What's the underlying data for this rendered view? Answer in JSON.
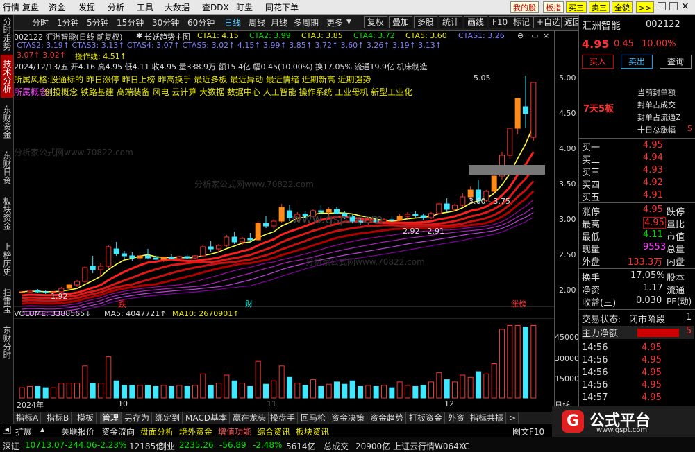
{
  "menu": [
    "行情",
    "复盘",
    "资金",
    "发掘",
    "分析",
    "工具",
    "大数据",
    "查DDX",
    "盯盘",
    "同花下单"
  ],
  "menu_right": {
    "mine": "我的股",
    "board": "板指",
    "b3": "买三",
    "s3": "卖三",
    "all": "全貌",
    "more": ">>"
  },
  "toolbar": {
    "periods": [
      "分时",
      "1分钟",
      "5分钟",
      "15分钟",
      "30分钟",
      "60分钟",
      "日线",
      "周线",
      "月线",
      "多周期",
      "更多"
    ],
    "buttons": [
      "复权",
      "叠加",
      "多股",
      "统计",
      "画线",
      "F10",
      "标记",
      "+自选",
      "返回"
    ]
  },
  "lefttabs": [
    "分时走势",
    "技术分析",
    "东财资金",
    "东财日资",
    "板块资金",
    "上榜历史",
    "扫雷宝",
    "东财分时"
  ],
  "chart": {
    "title_code": "002122 汇洲智能(日线 前复权)",
    "indicator_name": "长妖趋势主图",
    "cta_values": [
      {
        "label": "CTA1: 4.15",
        "color": "#e8e800"
      },
      {
        "label": "CTA2: 3.99",
        "color": "#00e000"
      },
      {
        "label": "CTA3: 3.85",
        "color": "#e8e800"
      },
      {
        "label": "CTA4: 3.72",
        "color": "#00e000"
      },
      {
        "label": "CTA5: 3.60",
        "color": "#e8e800"
      },
      {
        "label": "CTAS1: 3.26",
        "color": "#8080ff"
      }
    ],
    "row2": "CTAS2: 3.19↑ CTAS3: 3.13↑ CTAS4: 3.07↑ CTAS5: 3.02↑ 4.15↑ 3.99↑ 3.85↑ 3.72↑ 3.60↑ 3.26↑ 3.19↑ 3.13↑",
    "row3_a": "3.07↑ 3.02↑",
    "row3_b": "操作线: 4.51↑",
    "ohlc": "2024/12/13/五 开4.16 高4.95 低4.11 收4.95 量338.9万 额15.4亿 幅0.45(10.00%) 换17.05% 流通19.9亿 机床制造",
    "concept1": "所属风格:股通标的 昨日涨停 昨日上榜 昨高换手 最近多板 最近异动 最近情绪 近期新高 近期强势",
    "concept2_label": "所属概念:",
    "concept2": "创投概念 铁路基建 高端装备 风电 云计算 大数据 数据中心 人工智能 操作系统 工业母机 新型工业化",
    "watermark": "分析家公式网www.70822.com",
    "watermark2": "www.gspt.com",
    "price_labels": [
      "5.00",
      "4.50",
      "4.00",
      "3.50",
      "3.00",
      "2.50",
      "2.00"
    ],
    "annot_high": "5.05",
    "annot_seven": "7天5板",
    "annot_range1": "3.60 - 3.75",
    "annot_range2": "2.92 - 2.91",
    "annot_low": "1.92",
    "marks": [
      "跌",
      "财",
      "涨榜"
    ],
    "volume_label": "VOLUME: 3388565↓",
    "ma5_label": "MA5: 4047721↑",
    "ma10_label": "MA10: 2670901↑",
    "vol_axis": [
      "45000",
      "30000",
      "15000"
    ],
    "x_labels": [
      "2024年",
      "10",
      "11",
      "12"
    ],
    "period_label": "日线"
  },
  "chart_data": {
    "type": "candlestick",
    "price_range": [
      1.8,
      5.1
    ],
    "candles": [
      [
        1.92,
        1.95,
        1.9,
        1.93
      ],
      [
        1.93,
        1.96,
        1.91,
        1.95
      ],
      [
        1.95,
        1.97,
        1.92,
        1.93
      ],
      [
        1.93,
        1.95,
        1.9,
        1.92
      ],
      [
        1.92,
        1.94,
        1.9,
        1.93
      ],
      [
        1.93,
        2.0,
        1.92,
        1.98
      ],
      [
        1.98,
        2.05,
        1.96,
        2.03
      ],
      [
        2.03,
        2.1,
        2.0,
        2.08
      ],
      [
        2.08,
        2.3,
        2.06,
        2.28
      ],
      [
        2.3,
        2.45,
        2.2,
        2.25
      ],
      [
        2.25,
        2.35,
        2.15,
        2.3
      ],
      [
        2.3,
        2.6,
        2.28,
        2.58
      ],
      [
        2.55,
        2.65,
        2.45,
        2.48
      ],
      [
        2.48,
        2.52,
        2.4,
        2.45
      ],
      [
        2.45,
        2.5,
        2.38,
        2.42
      ],
      [
        2.42,
        2.47,
        2.38,
        2.45
      ],
      [
        2.45,
        2.55,
        2.4,
        2.42
      ],
      [
        2.42,
        2.46,
        2.38,
        2.4
      ],
      [
        2.4,
        2.44,
        2.36,
        2.43
      ],
      [
        2.43,
        2.47,
        2.4,
        2.41
      ],
      [
        2.41,
        2.45,
        2.38,
        2.44
      ],
      [
        2.44,
        2.48,
        2.4,
        2.42
      ],
      [
        2.42,
        2.46,
        2.4,
        2.45
      ],
      [
        2.45,
        2.6,
        2.44,
        2.58
      ],
      [
        2.58,
        2.66,
        2.5,
        2.55
      ],
      [
        2.55,
        2.62,
        2.5,
        2.6
      ],
      [
        2.6,
        2.75,
        2.58,
        2.72
      ],
      [
        2.72,
        2.8,
        2.62,
        2.65
      ],
      [
        2.65,
        2.72,
        2.6,
        2.7
      ],
      [
        2.7,
        2.78,
        2.65,
        2.68
      ],
      [
        2.68,
        2.95,
        2.66,
        2.92
      ],
      [
        2.92,
        3.02,
        2.85,
        2.88
      ],
      [
        2.88,
        2.98,
        2.84,
        2.95
      ],
      [
        2.95,
        3.2,
        2.92,
        3.15
      ],
      [
        3.1,
        3.18,
        2.95,
        3.0
      ],
      [
        3.0,
        3.08,
        2.94,
        3.05
      ],
      [
        3.05,
        3.1,
        2.98,
        3.02
      ],
      [
        3.02,
        3.12,
        3.0,
        3.1
      ],
      [
        3.1,
        3.18,
        3.05,
        3.08
      ],
      [
        3.08,
        3.15,
        3.02,
        3.12
      ],
      [
        3.12,
        3.16,
        3.05,
        3.06
      ],
      [
        3.06,
        3.1,
        2.98,
        3.02
      ],
      [
        3.02,
        3.05,
        2.92,
        2.95
      ],
      [
        2.95,
        3.0,
        2.9,
        2.93
      ],
      [
        2.93,
        2.98,
        2.9,
        2.96
      ],
      [
        2.96,
        3.0,
        2.92,
        2.94
      ],
      [
        2.94,
        2.99,
        2.91,
        2.97
      ],
      [
        2.97,
        3.02,
        2.94,
        2.96
      ],
      [
        2.96,
        3.05,
        2.95,
        3.02
      ],
      [
        3.02,
        3.08,
        2.98,
        3.05
      ],
      [
        3.05,
        3.1,
        3.0,
        3.03
      ],
      [
        3.03,
        3.06,
        2.96,
        3.0
      ],
      [
        3.0,
        3.08,
        2.98,
        3.06
      ],
      [
        3.06,
        3.22,
        3.05,
        3.2
      ],
      [
        3.2,
        3.28,
        3.08,
        3.12
      ],
      [
        3.12,
        3.2,
        3.1,
        3.18
      ],
      [
        3.18,
        3.35,
        3.15,
        3.3
      ],
      [
        3.3,
        3.45,
        3.25,
        3.4
      ],
      [
        3.4,
        3.55,
        3.2,
        3.25
      ],
      [
        3.25,
        3.4,
        3.22,
        3.38
      ],
      [
        3.38,
        3.62,
        3.35,
        3.6
      ],
      [
        3.6,
        3.95,
        3.55,
        3.9
      ],
      [
        3.9,
        4.29,
        3.85,
        4.29
      ],
      [
        4.29,
        4.72,
        4.2,
        4.72
      ],
      [
        4.6,
        5.05,
        4.3,
        4.5
      ],
      [
        4.16,
        4.95,
        4.11,
        4.95
      ]
    ]
  },
  "rpanel": {
    "name": "汇洲智能",
    "code": "002122",
    "price": "4.95",
    "chg": "0.45",
    "pct": "10.00%",
    "buy": "买入",
    "sell": "卖出",
    "query": "查询",
    "hints": [
      "当前封单额",
      "封单占成交",
      "封单占流通Z",
      "十日总涨幅"
    ],
    "hint_val": "5",
    "bids": [
      {
        "l": "买一",
        "p": "4.95"
      },
      {
        "l": "买二",
        "p": "4.94"
      },
      {
        "l": "买三",
        "p": "4.93"
      },
      {
        "l": "买四",
        "p": "4.92"
      },
      {
        "l": "买五",
        "p": "4.91"
      }
    ],
    "stats": [
      {
        "l": "涨停",
        "v": "4.95",
        "r": "跌停"
      },
      {
        "l": "最高",
        "v": "4.95",
        "r": "量比"
      },
      {
        "l": "最低",
        "v": "4.11",
        "r": "市值"
      },
      {
        "l": "现量",
        "v": "9553",
        "r": "总量"
      },
      {
        "l": "外盘",
        "v": "133.3万",
        "r": "内盘"
      },
      {
        "l": "换手",
        "v": "17.05%",
        "r": "股本"
      },
      {
        "l": "净资",
        "v": "1.17",
        "r": "流通"
      },
      {
        "l": "收益(三)",
        "v": "0.030",
        "r": "PE(动)"
      }
    ],
    "status_label": "交易状态:",
    "status_val": "闭市阶段",
    "status_num": "1",
    "netflow": "主力净额",
    "netflow_val": "5",
    "ticks": [
      {
        "t": "14:56",
        "p": "4.95"
      },
      {
        "t": "14:56",
        "p": "4.95"
      },
      {
        "t": "14:56",
        "p": "4.95"
      },
      {
        "t": "14:56",
        "p": "4.95"
      },
      {
        "t": "14:57",
        "p": "4.95"
      }
    ]
  },
  "btabs": [
    "指标A",
    "指标B",
    "模板",
    "管理",
    "另存为",
    "绑定到",
    "MACD基本",
    "赢在龙头",
    "操盘手",
    "回马枪",
    "资金决策",
    "资金趋势",
    "打板资金",
    "外资",
    "指标共振",
    ">"
  ],
  "brow2": [
    "扩展",
    "关联报价",
    "资金流向",
    "盘面分析",
    "境外资金",
    "增值功能",
    "综合资讯",
    "板块资讯"
  ],
  "brow2_right": "图文F10",
  "brow3": {
    "sz": "深证",
    "sz_v": "10713.07-244.06",
    "sz_p": "-2.23%",
    "sz_amt": "12185亿",
    "cy": "创业",
    "cy_v": "2235.26",
    "cy_c": "-56.89",
    "cy_p": "-2.48%",
    "cy_amt": "5614亿",
    "total": "总成交",
    "total_v": "20900亿",
    "news": "上证云行情W064XC"
  },
  "logo": {
    "text": "公式平台",
    "url": "www.gspt.com"
  }
}
